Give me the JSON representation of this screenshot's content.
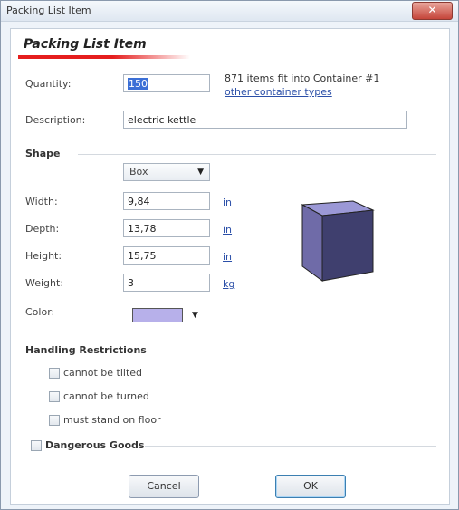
{
  "window": {
    "title": "Packing List Item",
    "close_glyph": "✕"
  },
  "header": {
    "title": "Packing List Item"
  },
  "quantity": {
    "label": "Quantity:",
    "value": "150",
    "info": "871 items fit into Container #1",
    "link": "other container types"
  },
  "description": {
    "label": "Description:",
    "value": "electric kettle"
  },
  "shape": {
    "section": "Shape",
    "type": "Box",
    "width": {
      "label": "Width:",
      "value": "9,84",
      "unit": "in"
    },
    "depth": {
      "label": "Depth:",
      "value": "13,78",
      "unit": "in"
    },
    "height": {
      "label": "Height:",
      "value": "15,75",
      "unit": "in"
    },
    "weight": {
      "label": "Weight:",
      "value": "3",
      "unit": "kg"
    },
    "color_label": "Color:",
    "color": "#b7b0ea"
  },
  "handling": {
    "section": "Handling Restrictions",
    "options": [
      "cannot be tilted",
      "cannot be turned",
      "must stand on floor"
    ]
  },
  "dangerous": {
    "label": "Dangerous Goods"
  },
  "buttons": {
    "cancel": "Cancel",
    "ok": "OK"
  },
  "colors": {
    "accent": "#e51d1d",
    "link": "#2b4fa8",
    "box_front": "#3f3f6e",
    "box_top": "#9b98d6",
    "box_side": "#6f6ba8"
  }
}
